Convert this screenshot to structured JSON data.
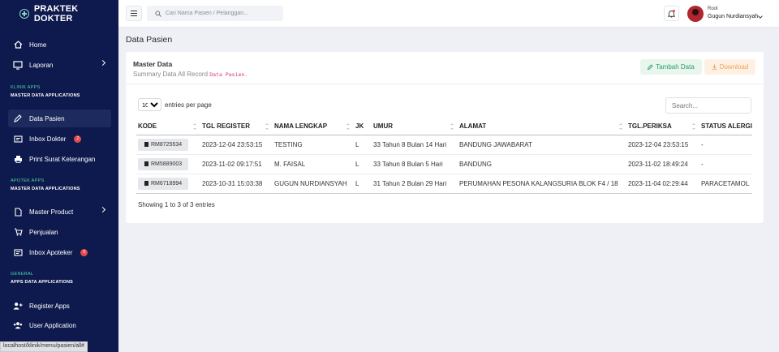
{
  "brand": {
    "name": "PRAKTEK DOKTER"
  },
  "sidebar": {
    "items": [
      {
        "label": "Home",
        "icon": "home-icon"
      },
      {
        "label": "Laporan",
        "icon": "report-icon"
      },
      {
        "label": "Data Pasien",
        "icon": "edit-icon",
        "active": true
      },
      {
        "label": "Inbox Dokter",
        "icon": "inbox-icon",
        "badge": "2"
      },
      {
        "label": "Print Surat Keterangan",
        "icon": "printer-icon"
      },
      {
        "label": "Master Product",
        "icon": "file-icon"
      },
      {
        "label": "Penjualan",
        "icon": "cart-icon"
      },
      {
        "label": "Inbox Apoteker",
        "icon": "inbox-icon",
        "badge": "0"
      },
      {
        "label": "Register Apps",
        "icon": "user-plus-icon"
      },
      {
        "label": "User Application",
        "icon": "users-icon"
      }
    ],
    "sections": [
      {
        "title": "KLINIK APPS",
        "subtitle": "MASTER DATA APPLICATIONS"
      },
      {
        "title": "APOTEK APPS",
        "subtitle": "MASTER DATA APPLICATIONS"
      },
      {
        "title": "GENERAL",
        "subtitle": "APPS DATA APPLICATIONS"
      }
    ]
  },
  "topbar": {
    "search_placeholder": "Cari Nama Pasien / Pelanggan...",
    "user_role": "Root",
    "user_name": "Gugun Nurdiansyah"
  },
  "page": {
    "title": "Data Pasien"
  },
  "card": {
    "title": "Master Data",
    "subtitle_prefix": "Summary Data All Record",
    "subtitle_code": "Data Pasien.",
    "add_label": "Tambah Data",
    "download_label": "Download"
  },
  "table": {
    "entries_value": "10",
    "entries_label": "entries per page",
    "search_placeholder": "Search...",
    "columns": [
      "KODE",
      "TGL REGISTER",
      "NAMA LENGKAP",
      "JK",
      "UMUR",
      "ALAMAT",
      "TGL.PERIKSA",
      "STATUS ALERGI"
    ],
    "rows": [
      {
        "kode": "RM8725534",
        "tgl_register": "2023-12-04 23:53:15",
        "nama": "TESTING",
        "jk": "L",
        "umur": "33 Tahun 8 Bulan 14 Hari",
        "alamat": "BANDUNG JAWABARAT",
        "tgl_periksa": "2023-12-04 23:53:15",
        "alergi": "-"
      },
      {
        "kode": "RM5889003",
        "tgl_register": "2023-11-02 09:17:51",
        "nama": "M. FAISAL",
        "jk": "L",
        "umur": "33 Tahun 8 Bulan 5 Hari",
        "alamat": "BANDUNG",
        "tgl_periksa": "2023-11-02 18:49:24",
        "alergi": "-"
      },
      {
        "kode": "RM6718994",
        "tgl_register": "2023-10-31 15:03:38",
        "nama": "GUGUN NURDIANSYAH",
        "jk": "L",
        "umur": "31 Tahun 2 Bulan 29 Hari",
        "alamat": "PERUMAHAN PESONA KALANGSURIA BLOK F4 / 18",
        "tgl_periksa": "2023-11-04 02:29:44",
        "alergi": "PARACETAMOL"
      }
    ],
    "showing": "Showing 1 to 3 of 3 entries"
  },
  "statusbar": {
    "url": "localhost/klinik/menu/pasien/all#"
  },
  "colors": {
    "sidebar": "#0e1a4d",
    "accent_green": "#4fd6b0",
    "badge_red": "#e84a4a",
    "download": "#f0a35a",
    "add": "#2a9d6a"
  }
}
